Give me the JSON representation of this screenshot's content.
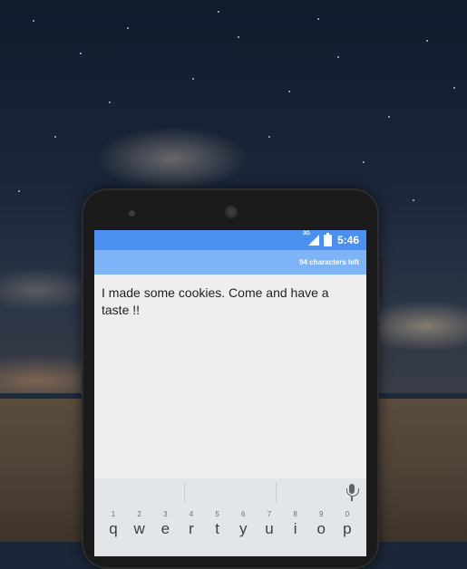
{
  "status_bar": {
    "network_label": "3G",
    "time": "5:46"
  },
  "action_bar": {
    "characters_left": "94 characters left"
  },
  "compose": {
    "message": "I made some cookies. Come and have a taste  !!"
  },
  "keyboard": {
    "keys": [
      {
        "hint": "1",
        "letter": "q"
      },
      {
        "hint": "2",
        "letter": "w"
      },
      {
        "hint": "3",
        "letter": "e"
      },
      {
        "hint": "4",
        "letter": "r"
      },
      {
        "hint": "5",
        "letter": "t"
      },
      {
        "hint": "6",
        "letter": "y"
      },
      {
        "hint": "7",
        "letter": "u"
      },
      {
        "hint": "8",
        "letter": "i"
      },
      {
        "hint": "9",
        "letter": "o"
      },
      {
        "hint": "0",
        "letter": "p"
      }
    ],
    "voice_icon": "mic-icon"
  },
  "colors": {
    "status_bar": "#4b8ff0",
    "action_bar": "#7fb3f8",
    "screen_bg": "#eeeeee",
    "keyboard_bg": "#e3e6e8"
  }
}
